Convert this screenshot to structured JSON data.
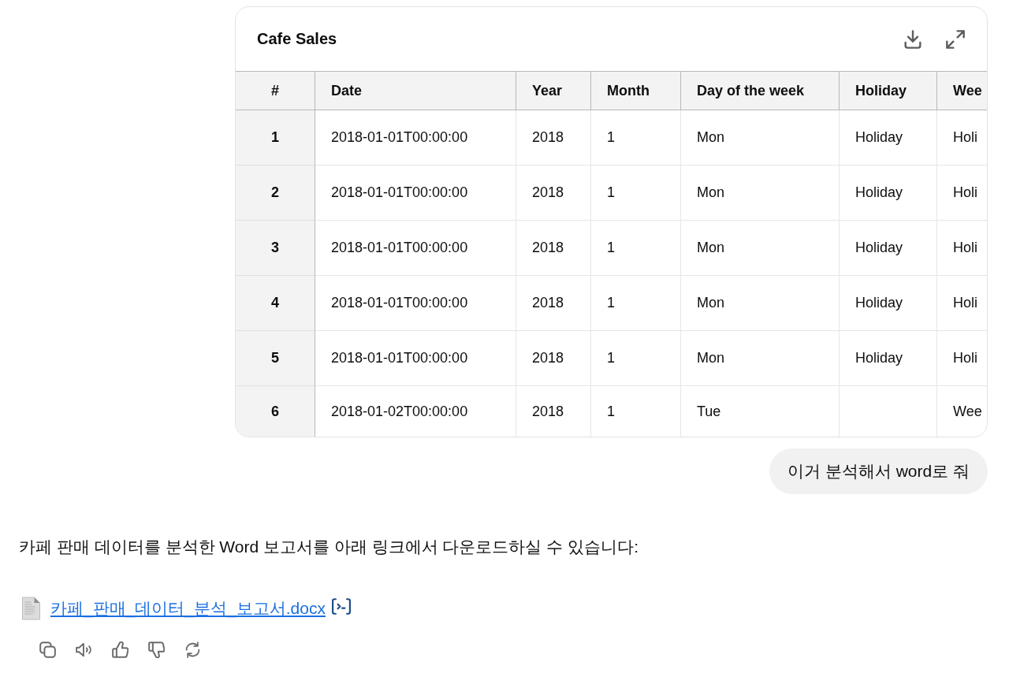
{
  "card": {
    "title": "Cafe Sales"
  },
  "table": {
    "columns": [
      "#",
      "Date",
      "Year",
      "Month",
      "Day of the week",
      "Holiday",
      "Wee"
    ],
    "rows": [
      {
        "number": "1",
        "date": "2018-01-01T00:00:00",
        "year": "2018",
        "month": "1",
        "day_of_the_week": "Mon",
        "holiday": "Holiday",
        "column_7": "Holi"
      },
      {
        "number": "2",
        "date": "2018-01-01T00:00:00",
        "year": "2018",
        "month": "1",
        "day_of_the_week": "Mon",
        "holiday": "Holiday",
        "column_7": "Holi"
      },
      {
        "number": "3",
        "date": "2018-01-01T00:00:00",
        "year": "2018",
        "month": "1",
        "day_of_the_week": "Mon",
        "holiday": "Holiday",
        "column_7": "Holi"
      },
      {
        "number": "4",
        "date": "2018-01-01T00:00:00",
        "year": "2018",
        "month": "1",
        "day_of_the_week": "Mon",
        "holiday": "Holiday",
        "column_7": "Holi"
      },
      {
        "number": "5",
        "date": "2018-01-01T00:00:00",
        "year": "2018",
        "month": "1",
        "day_of_the_week": "Mon",
        "holiday": "Holiday",
        "column_7": "Holi"
      },
      {
        "number": "6",
        "date": "2018-01-02T00:00:00",
        "year": "2018",
        "month": "1",
        "day_of_the_week": "Tue",
        "column_7": "Wee"
      }
    ]
  },
  "user_message": {
    "text": "이거 분석해서 word로 줘"
  },
  "assistant_message": {
    "text": "카페 판매 데이터를 분석한 Word 보고서를 아래 링크에서 다운로드하실 수 있습니다:",
    "attachment": {
      "file_name": "카페_판매_데이터_분석_보고서.docx"
    }
  }
}
